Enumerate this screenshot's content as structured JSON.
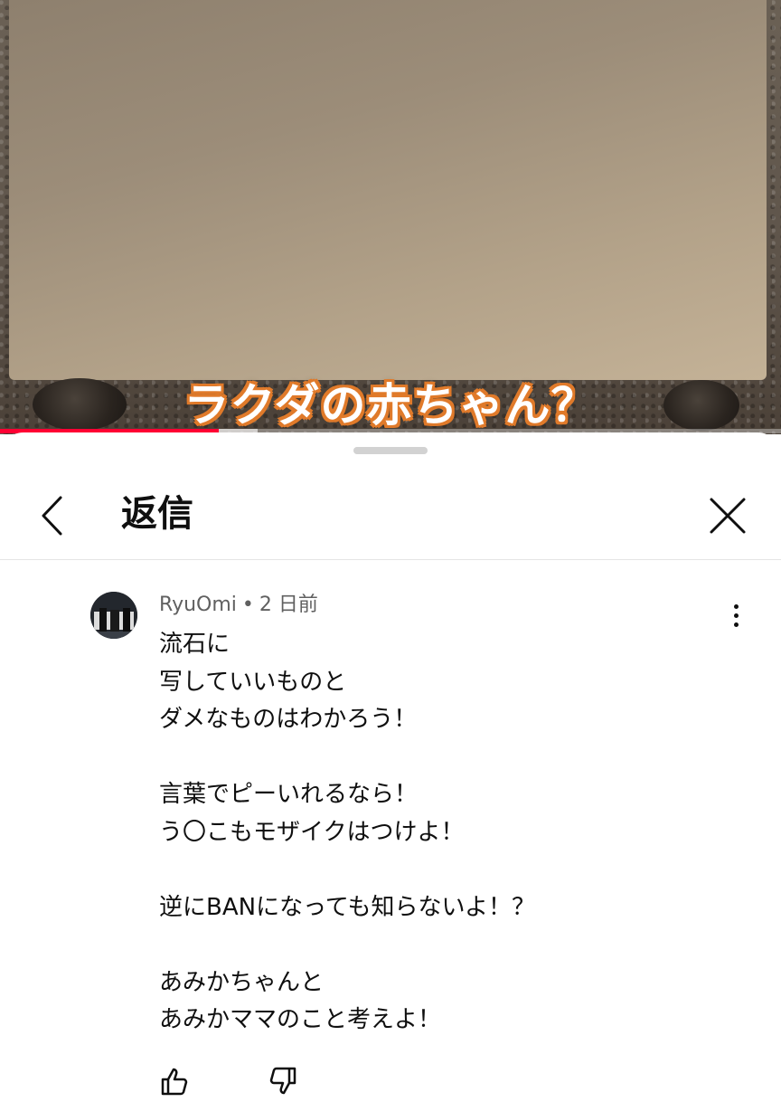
{
  "video": {
    "caption": "ラクダの赤ちゃん？",
    "progress": 0.28,
    "buffered": 0.33,
    "accent_color": "#ff0033"
  },
  "sheet": {
    "title": "返信",
    "back_icon": "chevron-left-icon",
    "close_icon": "close-icon"
  },
  "comment": {
    "author": "RyuOmi",
    "separator": "•",
    "time": "2 日前",
    "menu_icon": "more-vertical-icon",
    "lines": [
      "流石に",
      "写していいものと",
      "ダメなものはわかろう！",
      "",
      "言葉でピーいれるなら！",
      "う〇こもモザイクはつけよ！",
      "",
      "逆にBANになっても知らないよ！？",
      "",
      "あみかちゃんと",
      "あみかママのこと考えよ！"
    ],
    "like_icon": "thumbs-up-icon",
    "dislike_icon": "thumbs-down-icon"
  }
}
